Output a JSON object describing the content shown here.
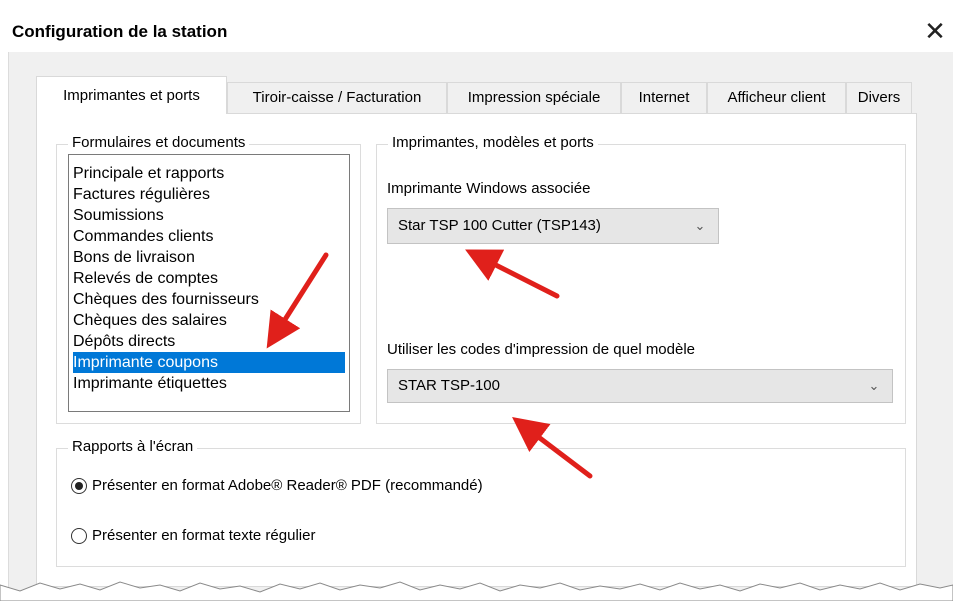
{
  "window": {
    "title": "Configuration de la station",
    "close_glyph": "✕"
  },
  "tabs": [
    {
      "label": "Imprimantes et ports",
      "active": true
    },
    {
      "label": "Tiroir-caisse / Facturation",
      "active": false
    },
    {
      "label": "Impression spéciale",
      "active": false
    },
    {
      "label": "Internet",
      "active": false
    },
    {
      "label": "Afficheur client",
      "active": false
    },
    {
      "label": "Divers",
      "active": false
    }
  ],
  "forms_group": {
    "title": "Formulaires et documents",
    "items": [
      "Principale et rapports",
      "Factures régulières",
      "Soumissions",
      "Commandes clients",
      "Bons de livraison",
      "Relevés de comptes",
      "Chèques des fournisseurs",
      "Chèques des salaires",
      "Dépôts directs",
      "Imprimante coupons",
      "Imprimante étiquettes"
    ],
    "selected_index": 9
  },
  "printers_group": {
    "title": "Imprimantes, modèles et ports",
    "windows_printer_label": "Imprimante Windows associée",
    "windows_printer_value": "Star TSP 100 Cutter (TSP143)",
    "model_label": "Utiliser les codes d'impression de quel modèle",
    "model_value": "STAR TSP-100"
  },
  "reports_group": {
    "title": "Rapports à l'écran",
    "options": [
      {
        "label": "Présenter en format Adobe® Reader® PDF (recommandé)",
        "checked": true
      },
      {
        "label": "Présenter en format texte régulier",
        "checked": false
      }
    ]
  },
  "icons": {
    "chevron": "chevron-down-icon",
    "close": "close-icon",
    "annotation": "red-arrow-icon"
  },
  "colors": {
    "selection": "#0078d7",
    "annotation_arrow": "#e0201b"
  }
}
